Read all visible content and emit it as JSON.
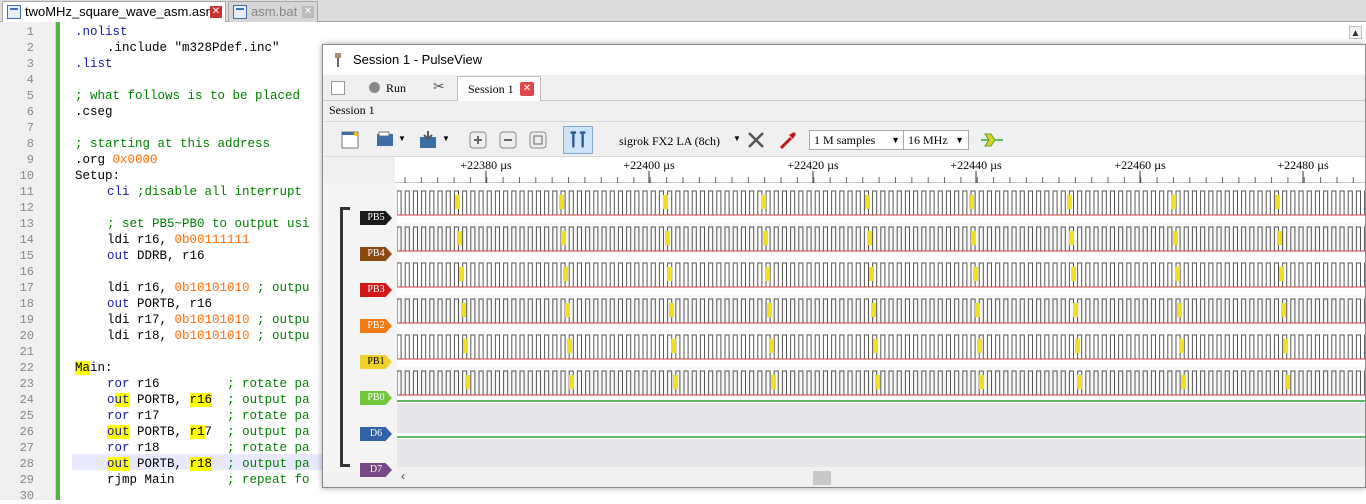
{
  "editor_tabs": [
    {
      "label": "twoMHz_square_wave_asm.asm",
      "active": true
    },
    {
      "label": "asm.bat",
      "active": false
    }
  ],
  "code_lines": [
    "1",
    "2",
    "3",
    "4",
    "5",
    "6",
    "7",
    "8",
    "9",
    "10",
    "11",
    "12",
    "13",
    "14",
    "15",
    "16",
    "17",
    "18",
    "19",
    "20",
    "21",
    "22",
    "23",
    "24",
    "25",
    "26",
    "27",
    "28",
    "29",
    "30"
  ],
  "code": {
    "l1": ".nolist",
    "l2": ".include \"m328Pdef.inc\"",
    "l3": ".list",
    "l5": "; what follows is to be placed",
    "l6": ".cseg",
    "l8": "; starting at this address",
    "l9a": ".org ",
    "l9b": "0x0000",
    "l10": "Setup:",
    "l11a": "cli",
    "l11b": " ;disable all interrupt",
    "l13": "; set PB5~PB0 to output usi",
    "l14a": "ldi r16, ",
    "l14b": "0b00111111",
    "l15a": "out",
    "l15b": " DDRB, r16",
    "l17a": "ldi r16, ",
    "l17b": "0b10101010",
    "l17c": " ; outpu",
    "l18a": "out",
    "l18b": " PORTB, r16",
    "l19a": "ldi r17, ",
    "l19b": "0b10101010",
    "l19c": " ; outpu",
    "l20a": "ldi r18, ",
    "l20b": "0b10101010",
    "l20c": " ; outpu",
    "l22a": "Ma",
    "l22b": "in:",
    "l23a": "ror",
    "l23b": " r16         ",
    "l23c": "; rotate pa",
    "l24a": "o",
    "l24b": "ut",
    " l24c": "",
    "l24d": " PORTB, ",
    "l24e": "r16",
    "l24f": "  ",
    "l24g": "; output pa",
    "l25a": "ror",
    "l25b": " r17         ",
    "l25c": "; rotate pa",
    "l26a": "out",
    "l26b": " PORTB, ",
    "l26c": "r1",
    "l26d": "7",
    "l26e": "  ",
    "l26f": "; output pa",
    "l27a": "ror",
    "l27b": " r18         ",
    "l27c": "; rotate pa",
    "l28a": "out",
    "l28b": " PORTB, ",
    "l28c": "r18",
    "l28d": "  ",
    "l28e": "; output pa",
    "l29a": "rjmp ",
    "l29b": "Main",
    "l29c": "       ",
    "l29d": "; repeat fo"
  },
  "pulseview": {
    "window_title": "Session 1 - PulseView",
    "run_label": "Run",
    "session_tab": "Session 1",
    "session_label": "Session 1",
    "device": "sigrok FX2 LA (8ch)",
    "samples": "1 M samples",
    "samplerate": "16 MHz",
    "ruler_ticks": [
      "+22380 µs",
      "+22400 µs",
      "+22420 µs",
      "+22440 µs",
      "+22460 µs",
      "+22480 µs"
    ],
    "channels": [
      {
        "name": "PB5",
        "color": "#1a1a1a"
      },
      {
        "name": "PB4",
        "color": "#8a4a10"
      },
      {
        "name": "PB3",
        "color": "#d01818"
      },
      {
        "name": "PB2",
        "color": "#f27a14"
      },
      {
        "name": "PB1",
        "color": "#f0d22a"
      },
      {
        "name": "PB0",
        "color": "#72c63c"
      },
      {
        "name": "D6",
        "color": "#3263a8"
      },
      {
        "name": "D7",
        "color": "#7a4a86"
      }
    ]
  }
}
